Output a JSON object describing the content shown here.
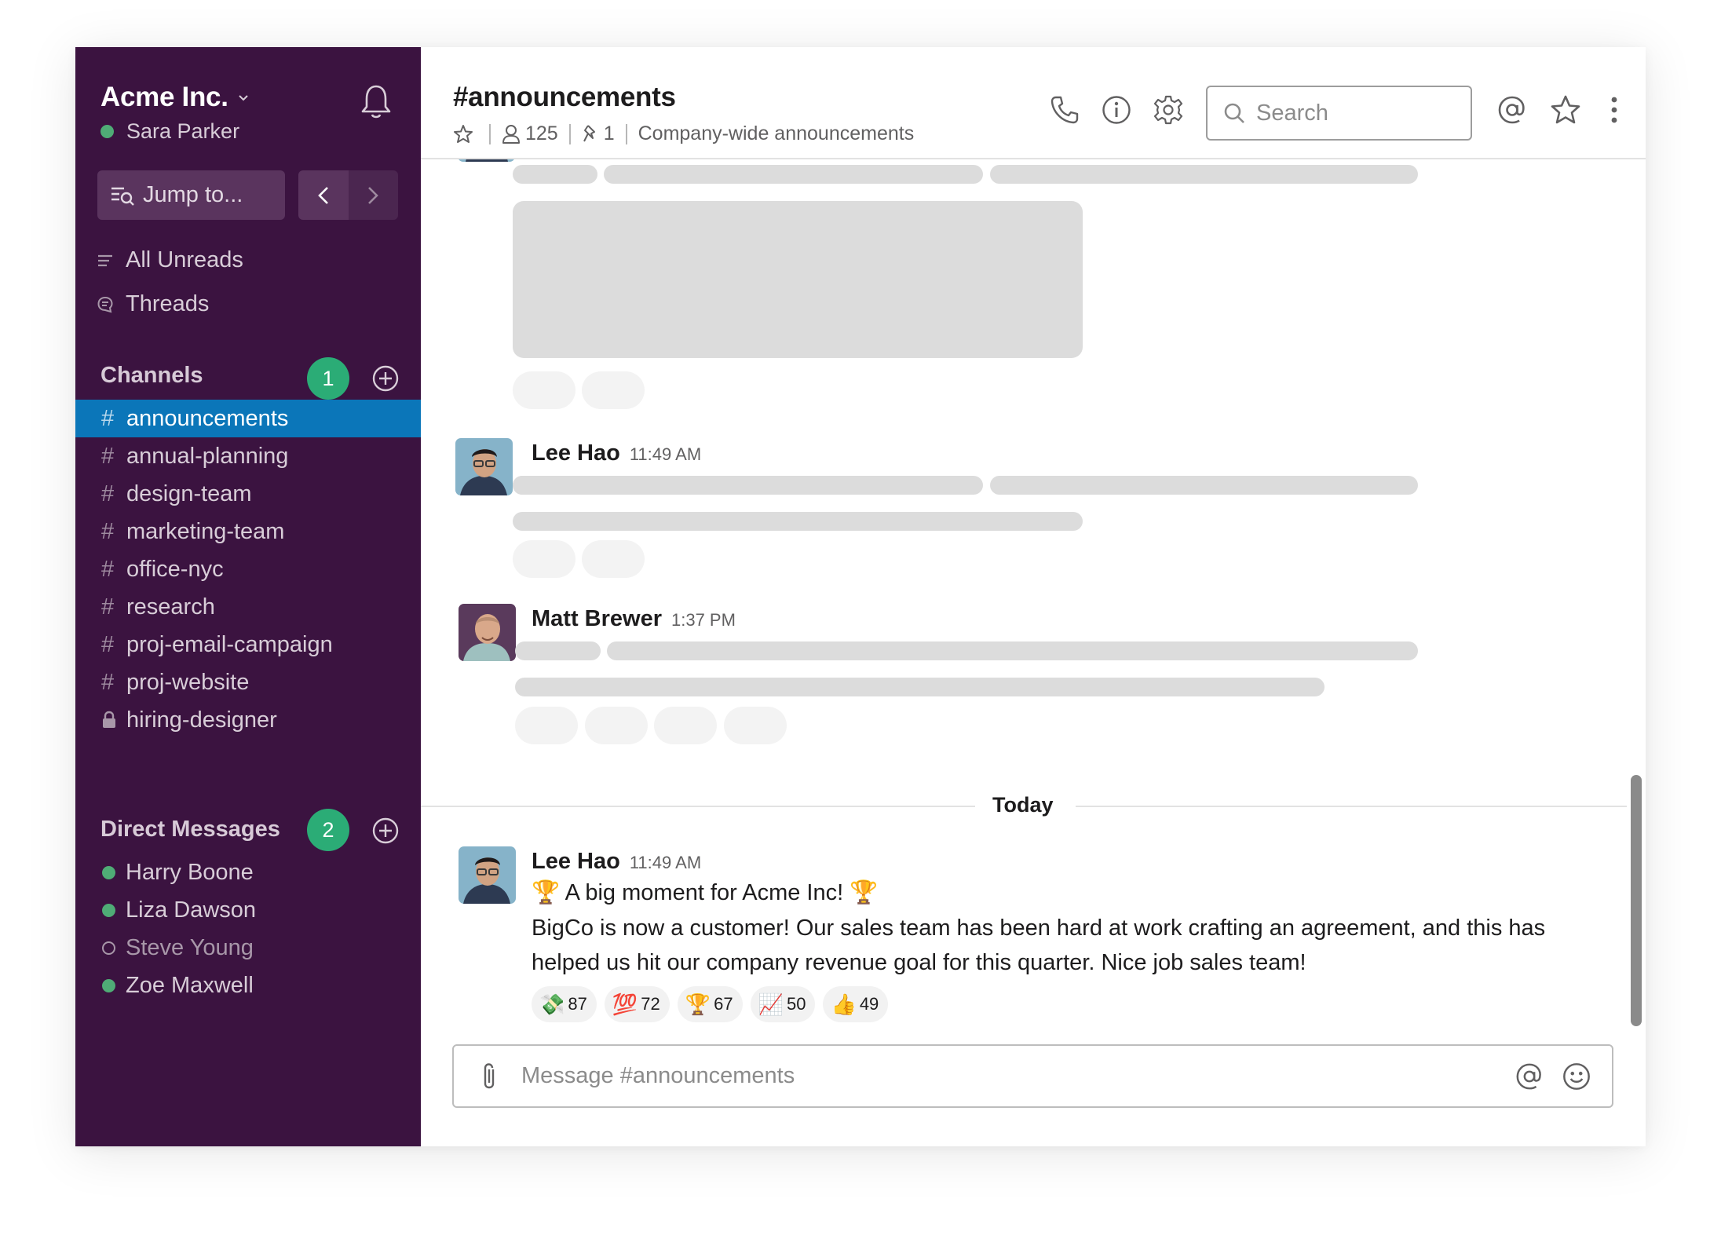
{
  "workspace": {
    "name": "Acme Inc.",
    "user": "Sara Parker",
    "user_status": "active"
  },
  "sidebar": {
    "jump_to": "Jump to...",
    "nav_items": [
      {
        "label": "All Unreads",
        "icon": "all-unreads-icon"
      },
      {
        "label": "Threads",
        "icon": "threads-icon"
      }
    ],
    "channels_header": "Channels",
    "channels_badge": "1",
    "channels": [
      {
        "name": "announcements",
        "icon": "hash",
        "active": true
      },
      {
        "name": "annual-planning",
        "icon": "hash"
      },
      {
        "name": "design-team",
        "icon": "hash"
      },
      {
        "name": "marketing-team",
        "icon": "hash"
      },
      {
        "name": "office-nyc",
        "icon": "hash"
      },
      {
        "name": "research",
        "icon": "hash"
      },
      {
        "name": "proj-email-campaign",
        "icon": "hash"
      },
      {
        "name": "proj-website",
        "icon": "hash"
      },
      {
        "name": "hiring-designer",
        "icon": "lock"
      }
    ],
    "dm_header": "Direct Messages",
    "dm_badge": "2",
    "dms": [
      {
        "name": "Harry Boone",
        "status": "online"
      },
      {
        "name": "Liza Dawson",
        "status": "online"
      },
      {
        "name": "Steve Young",
        "status": "away"
      },
      {
        "name": "Zoe Maxwell",
        "status": "online"
      }
    ]
  },
  "header": {
    "channel_title": "#announcements",
    "member_count": "125",
    "pinned_count": "1",
    "topic": "Company-wide announcements",
    "search_placeholder": "Search"
  },
  "messages": [
    {
      "author": "Lee Hao",
      "time": "11:49 AM",
      "placeholder": true
    },
    {
      "author": "Matt Brewer",
      "time": "1:37 PM",
      "placeholder": true
    }
  ],
  "divider": "Today",
  "latest_message": {
    "author": "Lee Hao",
    "time": "11:49 AM",
    "title": "🏆 A big moment for Acme Inc! 🏆",
    "body": "BigCo is now a customer! Our sales team has been hard at work crafting an agreement, and this has helped us hit our company revenue goal for this quarter. Nice job sales team!",
    "reactions": [
      {
        "emoji": "💸",
        "count": "87"
      },
      {
        "emoji": "💯",
        "count": "72"
      },
      {
        "emoji": "🏆",
        "count": "67"
      },
      {
        "emoji": "📈",
        "count": "50"
      },
      {
        "emoji": "👍",
        "count": "49"
      }
    ]
  },
  "composer": {
    "placeholder": "Message #announcements"
  },
  "colors": {
    "sidebar_bg": "#3b1340",
    "active_channel": "#0b76b9",
    "badge": "#2bac76",
    "presence": "#4fac76"
  }
}
